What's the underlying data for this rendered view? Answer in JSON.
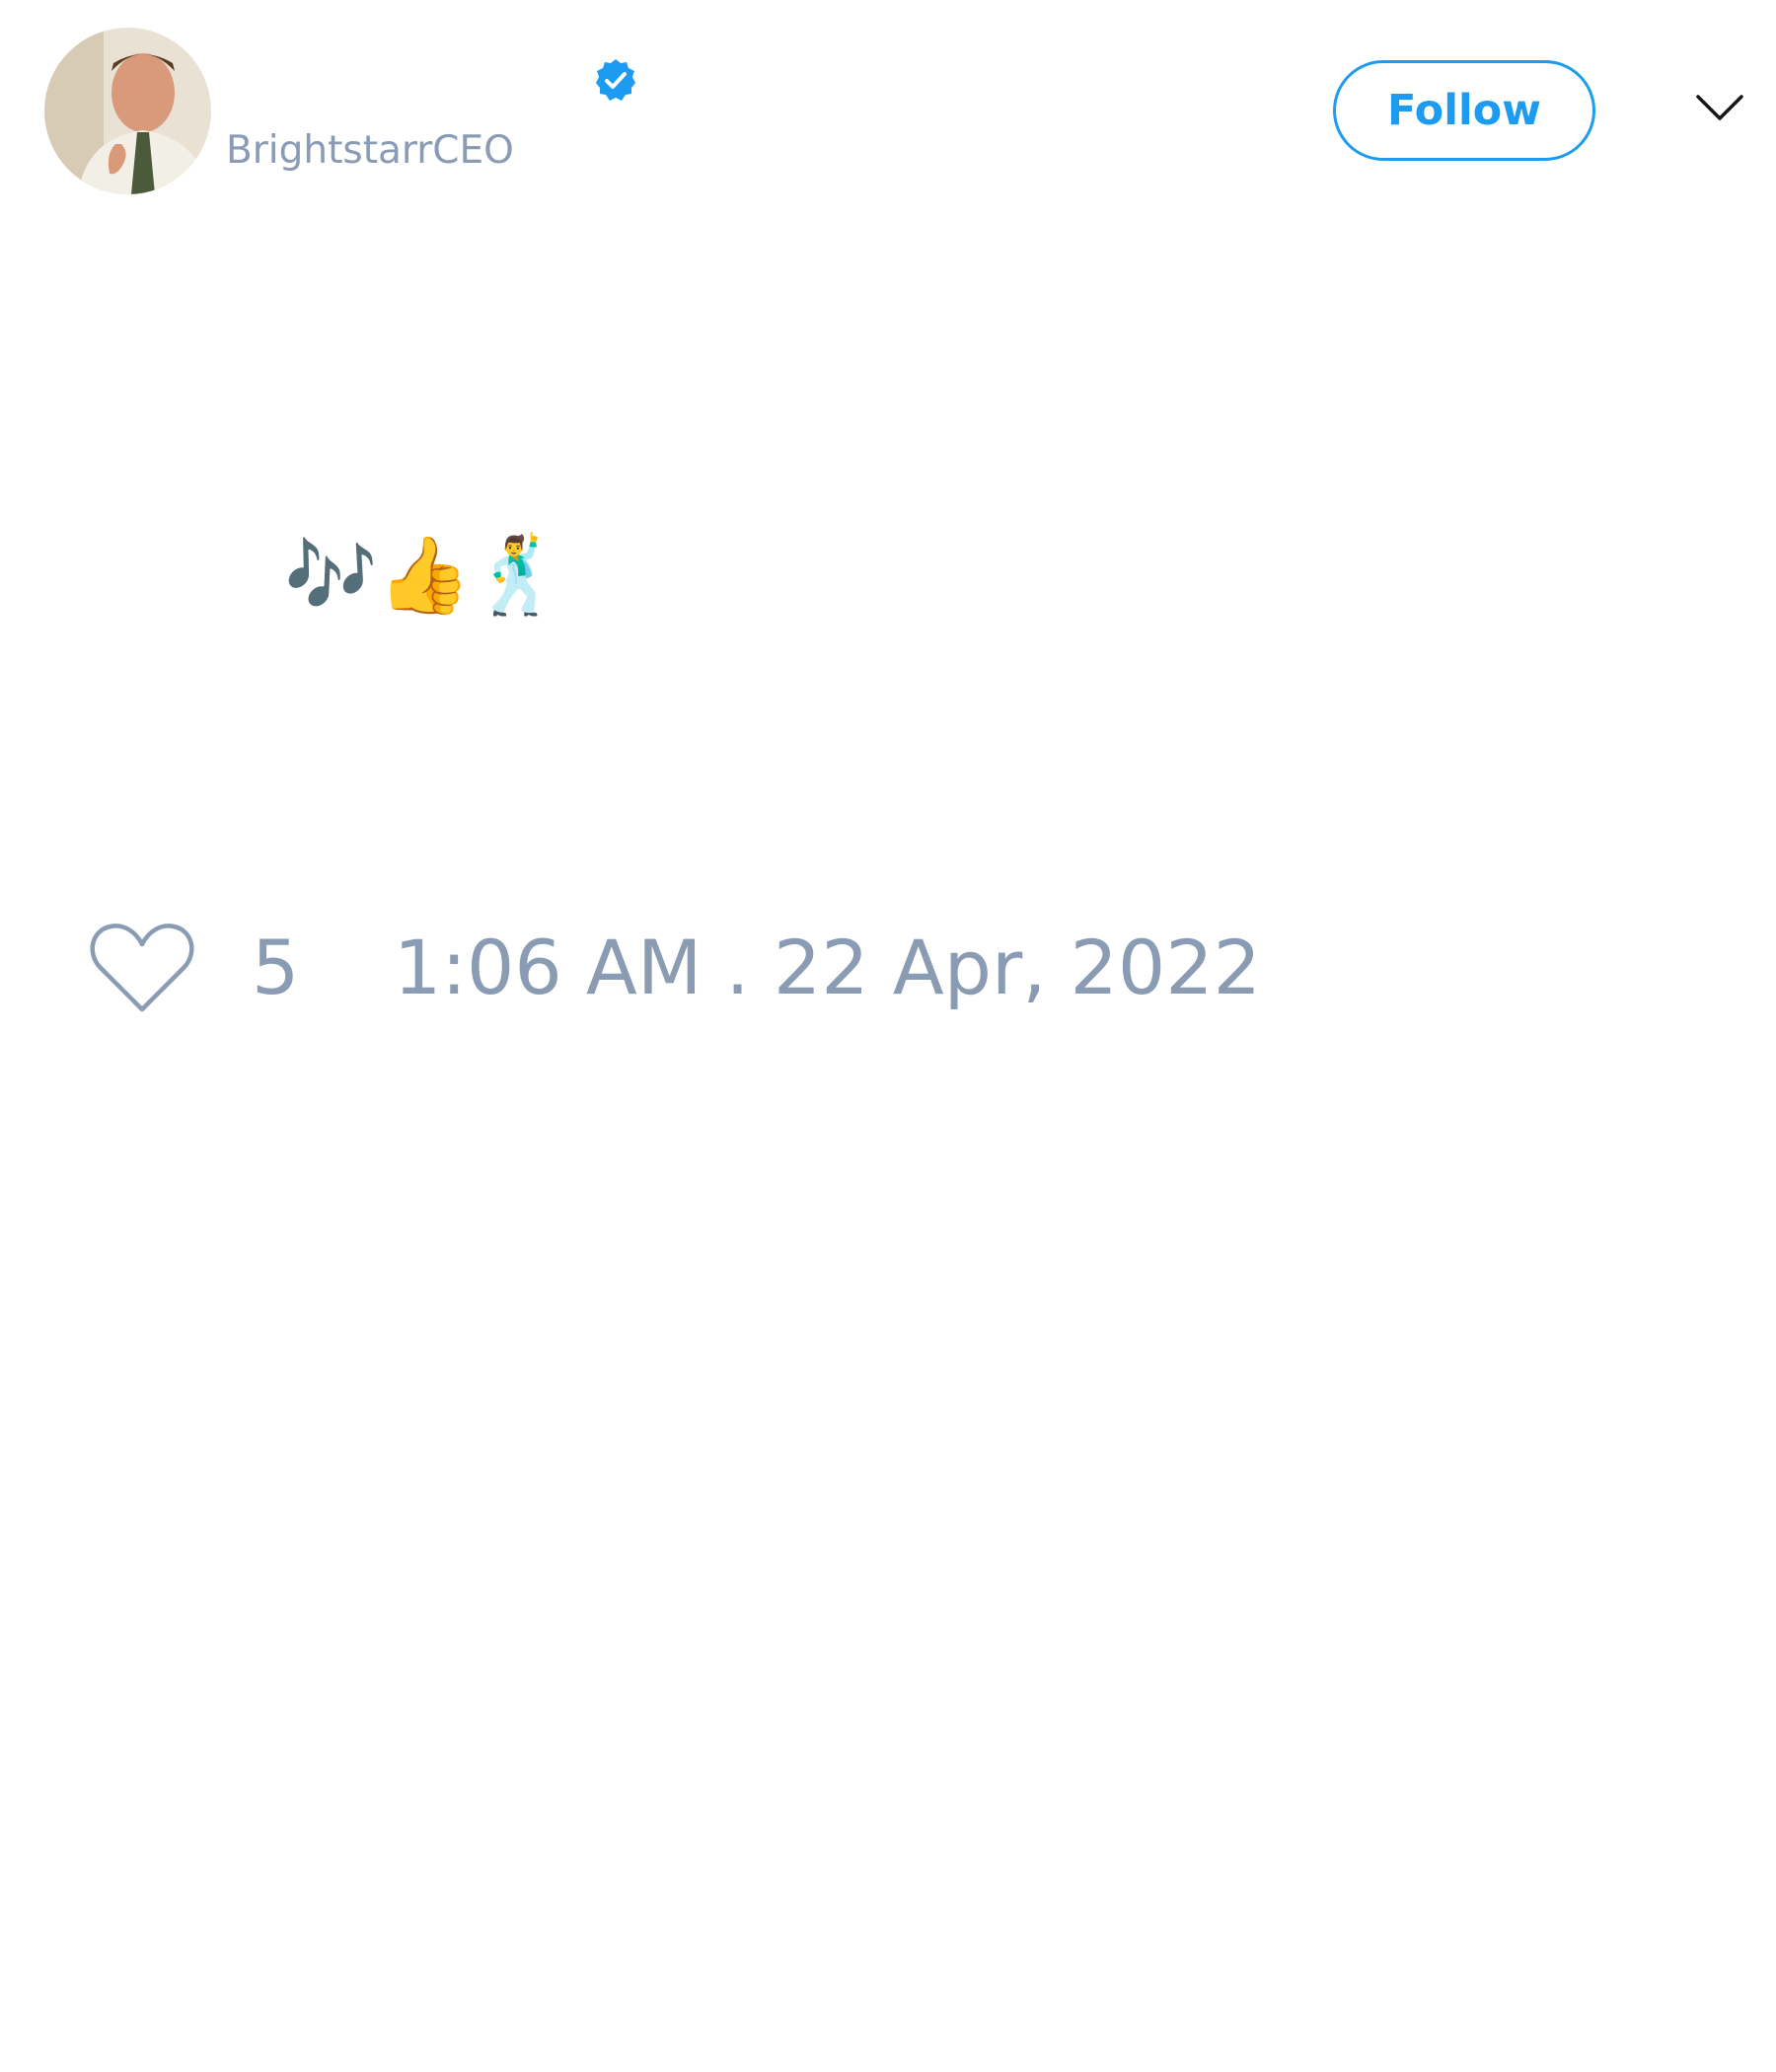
{
  "tweet": {
    "author": {
      "display_name": "",
      "handle": "BrightstarrCEO",
      "verified": true,
      "avatar_icon": "profile-photo"
    },
    "follow_label": "Follow",
    "menu_icon": "chevron-down-icon",
    "text": "🎶👍🕺",
    "likes": "5",
    "timestamp": "1:06 AM . 22 Apr, 2022"
  },
  "colors": {
    "accent": "#1d9bf0",
    "secondary_text": "#8a9bb4",
    "background": "#ffffff"
  }
}
